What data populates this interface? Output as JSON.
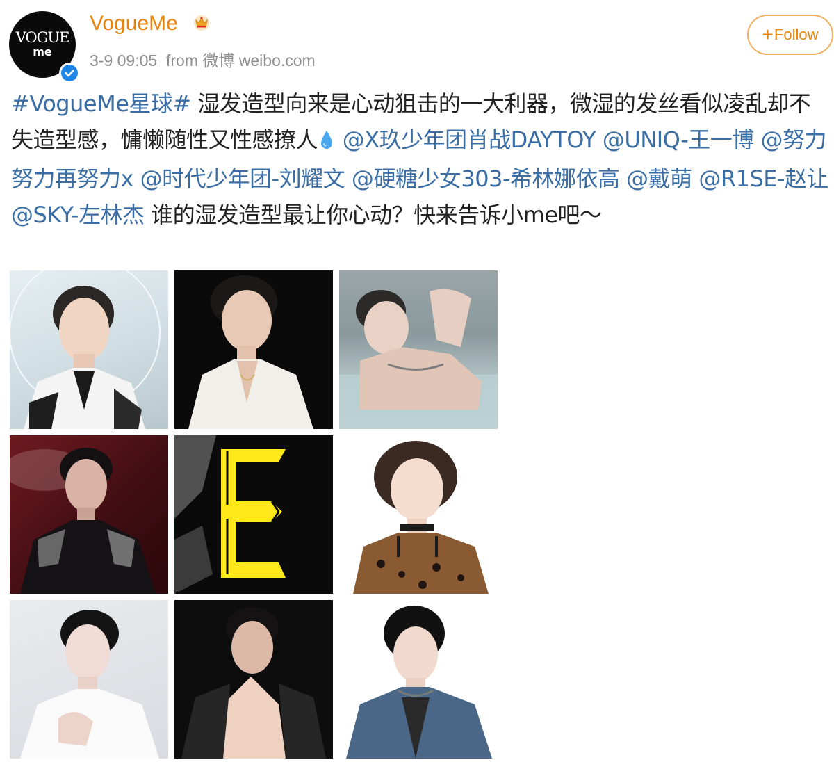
{
  "post": {
    "username": "VogueMe",
    "avatar_text": {
      "line1": "VOGUE",
      "line2": "me"
    },
    "time": "3-9 09:05",
    "source": "from 微博 weibo.com",
    "follow_button": {
      "plus": "+",
      "label": "Follow"
    },
    "text": {
      "hashtag": "#VogueMe星球#",
      "body1": " 湿发造型向来是心动狙击的一大利器，微湿的发丝看似凌乱却不失造型感，慵懒随性又性感撩人",
      "mentions": [
        {
          "text": "@X玖少年团肖战DAYTOY"
        },
        {
          "text": "@UNIQ-王一博"
        },
        {
          "text": "@努力努力再努力x"
        },
        {
          "text": "@时代少年团-刘耀文"
        },
        {
          "text": "@硬糖少女303-希林娜依高"
        },
        {
          "text": "@戴萌"
        },
        {
          "text": "@R1SE-赵让"
        },
        {
          "text": "@SKY-左林杰"
        }
      ],
      "body2": " 谁的湿发造型最让你心动？快来告诉小me吧～"
    },
    "images": [
      {
        "description_icon": "photo-1"
      },
      {
        "description_icon": "photo-2"
      },
      {
        "description_icon": "photo-3"
      },
      {
        "description_icon": "photo-4"
      },
      {
        "description_icon": "photo-5"
      },
      {
        "description_icon": "photo-6"
      },
      {
        "description_icon": "photo-7"
      },
      {
        "description_icon": "photo-8"
      },
      {
        "description_icon": "photo-9"
      }
    ]
  },
  "colors": {
    "username": "#e8830c",
    "link": "#3a6ea5",
    "meta": "#8e8e8e",
    "follow_border": "#f0b060",
    "verified": "#1f86e8"
  }
}
